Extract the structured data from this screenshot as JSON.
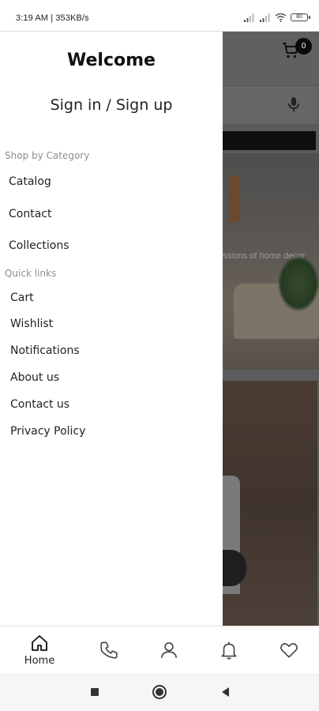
{
  "status_bar": {
    "time": "3:19 AM | 353KB/s",
    "battery": "80"
  },
  "background_app": {
    "cart_count": "0",
    "hero_caption": "ssions of home decor"
  },
  "drawer": {
    "title": "Welcome",
    "sign_in_label": "Sign in / Sign up",
    "shop_section_label": "Shop by Category",
    "shop_items": [
      {
        "label": "Catalog"
      },
      {
        "label": "Contact"
      },
      {
        "label": "Collections"
      }
    ],
    "quick_section_label": "Quick links",
    "quick_items": [
      {
        "label": "Cart"
      },
      {
        "label": "Wishlist"
      },
      {
        "label": "Notifications"
      },
      {
        "label": "About us"
      },
      {
        "label": "Contact us"
      },
      {
        "label": "Privacy Policy"
      }
    ]
  },
  "bottom_nav": {
    "items": [
      {
        "label": "Home",
        "icon": "home-icon",
        "active": true
      },
      {
        "label": "",
        "icon": "phone-icon"
      },
      {
        "label": "",
        "icon": "user-icon"
      },
      {
        "label": "",
        "icon": "bell-icon"
      },
      {
        "label": "",
        "icon": "heart-icon"
      }
    ]
  },
  "system_nav": {
    "items": [
      "recents-icon",
      "home-circle-icon",
      "back-icon"
    ]
  },
  "colors": {
    "text_primary": "#222222",
    "section_label": "#8e8e8e",
    "overlay_dim": "#5b5b5b",
    "badge": "#0a0a0a"
  }
}
